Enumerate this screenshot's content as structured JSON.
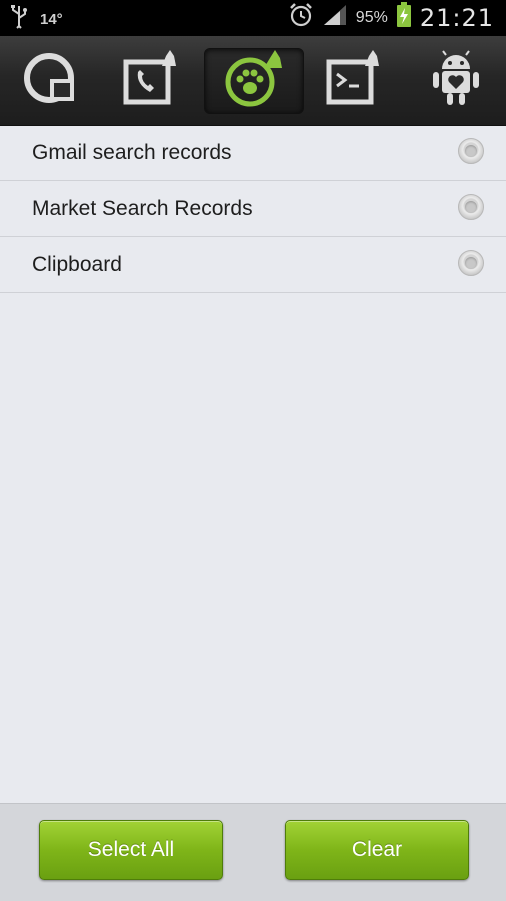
{
  "status_bar": {
    "temperature": "14°",
    "battery_percent": "95%",
    "time": "21:21",
    "icons": [
      "usb-icon",
      "alarm-icon",
      "signal-icon",
      "battery-charging-icon"
    ]
  },
  "tabs": [
    {
      "icon": "cache-cleaner-icon",
      "active": false
    },
    {
      "icon": "call-log-cleaner-icon",
      "active": false
    },
    {
      "icon": "history-cleaner-icon",
      "active": true
    },
    {
      "icon": "sms-cleaner-icon",
      "active": false
    },
    {
      "icon": "android-app-icon",
      "active": false
    }
  ],
  "list": {
    "items": [
      {
        "label": "Gmail search records",
        "checked": false
      },
      {
        "label": "Market Search Records",
        "checked": false
      },
      {
        "label": "Clipboard",
        "checked": false
      }
    ]
  },
  "actions": {
    "select_all_label": "Select All",
    "clear_label": "Clear"
  },
  "colors": {
    "accent_green": "#7fb519",
    "active_icon_green": "#8cc63f"
  }
}
